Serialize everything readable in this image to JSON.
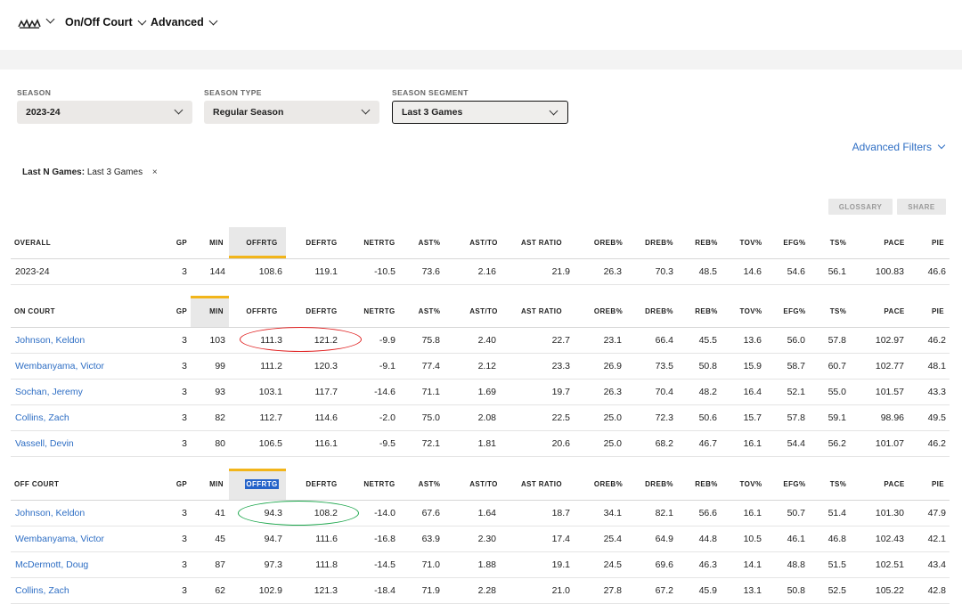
{
  "nav": {
    "logo_icon": "spurs-logo-icon",
    "team_chevron_icon": "chevron-down-icon",
    "items": [
      {
        "label": "On/Off Court"
      },
      {
        "label": "Advanced"
      }
    ]
  },
  "filters": [
    {
      "label": "SEASON",
      "value": "2023-24"
    },
    {
      "label": "SEASON TYPE",
      "value": "Regular Season"
    },
    {
      "label": "SEASON SEGMENT",
      "value": "Last 3 Games"
    }
  ],
  "advanced_filters_label": "Advanced Filters",
  "active_filter": {
    "key": "Last N Games:",
    "value": "Last 3 Games",
    "remove": "×"
  },
  "buttons": {
    "glossary": "GLOSSARY",
    "share": "SHARE"
  },
  "columns": [
    "GP",
    "MIN",
    "OFFRTG",
    "DEFRTG",
    "NETRTG",
    "AST%",
    "AST/TO",
    "AST RATIO",
    "OREB%",
    "DREB%",
    "REB%",
    "TOV%",
    "EFG%",
    "TS%",
    "PACE",
    "PIE"
  ],
  "overall": {
    "title": "OVERALL",
    "rows": [
      {
        "name": "2023-24",
        "values": [
          "3",
          "144",
          "108.6",
          "119.1",
          "-10.5",
          "73.6",
          "2.16",
          "21.9",
          "26.3",
          "70.3",
          "48.5",
          "14.6",
          "54.6",
          "56.1",
          "100.83",
          "46.6"
        ]
      }
    ]
  },
  "on_court": {
    "title": "ON COURT",
    "rows": [
      {
        "name": "Johnson, Keldon",
        "values": [
          "3",
          "103",
          "111.3",
          "121.2",
          "-9.9",
          "75.8",
          "2.40",
          "22.7",
          "23.1",
          "66.4",
          "45.5",
          "13.6",
          "56.0",
          "57.8",
          "102.97",
          "46.2"
        ]
      },
      {
        "name": "Wembanyama, Victor",
        "values": [
          "3",
          "99",
          "111.2",
          "120.3",
          "-9.1",
          "77.4",
          "2.12",
          "23.3",
          "26.9",
          "73.5",
          "50.8",
          "15.9",
          "58.7",
          "60.7",
          "102.77",
          "48.1"
        ]
      },
      {
        "name": "Sochan, Jeremy",
        "values": [
          "3",
          "93",
          "103.1",
          "117.7",
          "-14.6",
          "71.1",
          "1.69",
          "19.7",
          "26.3",
          "70.4",
          "48.2",
          "16.4",
          "52.1",
          "55.0",
          "101.57",
          "43.3"
        ]
      },
      {
        "name": "Collins, Zach",
        "values": [
          "3",
          "82",
          "112.7",
          "114.6",
          "-2.0",
          "75.0",
          "2.08",
          "22.5",
          "25.0",
          "72.3",
          "50.6",
          "15.7",
          "57.8",
          "59.1",
          "98.96",
          "49.5"
        ]
      },
      {
        "name": "Vassell, Devin",
        "values": [
          "3",
          "80",
          "106.5",
          "116.1",
          "-9.5",
          "72.1",
          "1.81",
          "20.6",
          "25.0",
          "68.2",
          "46.7",
          "16.1",
          "54.4",
          "56.2",
          "101.07",
          "46.2"
        ]
      }
    ]
  },
  "off_court": {
    "title": "OFF COURT",
    "rows": [
      {
        "name": "Johnson, Keldon",
        "values": [
          "3",
          "41",
          "94.3",
          "108.2",
          "-14.0",
          "67.6",
          "1.64",
          "18.7",
          "34.1",
          "82.1",
          "56.6",
          "16.1",
          "50.7",
          "51.4",
          "101.30",
          "47.9"
        ]
      },
      {
        "name": "Wembanyama, Victor",
        "values": [
          "3",
          "45",
          "94.7",
          "111.6",
          "-16.8",
          "63.9",
          "2.30",
          "17.4",
          "25.4",
          "64.9",
          "44.8",
          "10.5",
          "46.1",
          "46.8",
          "102.43",
          "42.1"
        ]
      },
      {
        "name": "McDermott, Doug",
        "values": [
          "3",
          "87",
          "97.3",
          "111.8",
          "-14.5",
          "71.0",
          "1.88",
          "19.1",
          "24.5",
          "69.6",
          "46.3",
          "14.1",
          "48.8",
          "51.5",
          "102.51",
          "43.4"
        ]
      },
      {
        "name": "Collins, Zach",
        "values": [
          "3",
          "62",
          "102.9",
          "121.3",
          "-18.4",
          "71.9",
          "2.28",
          "21.0",
          "27.8",
          "67.2",
          "45.9",
          "13.1",
          "50.8",
          "52.5",
          "105.22",
          "42.8"
        ]
      }
    ]
  },
  "colors": {
    "accent": "#f2b51a",
    "link": "#2e6ec4",
    "red_annotation": "#e02020",
    "green_annotation": "#1aa54a"
  }
}
